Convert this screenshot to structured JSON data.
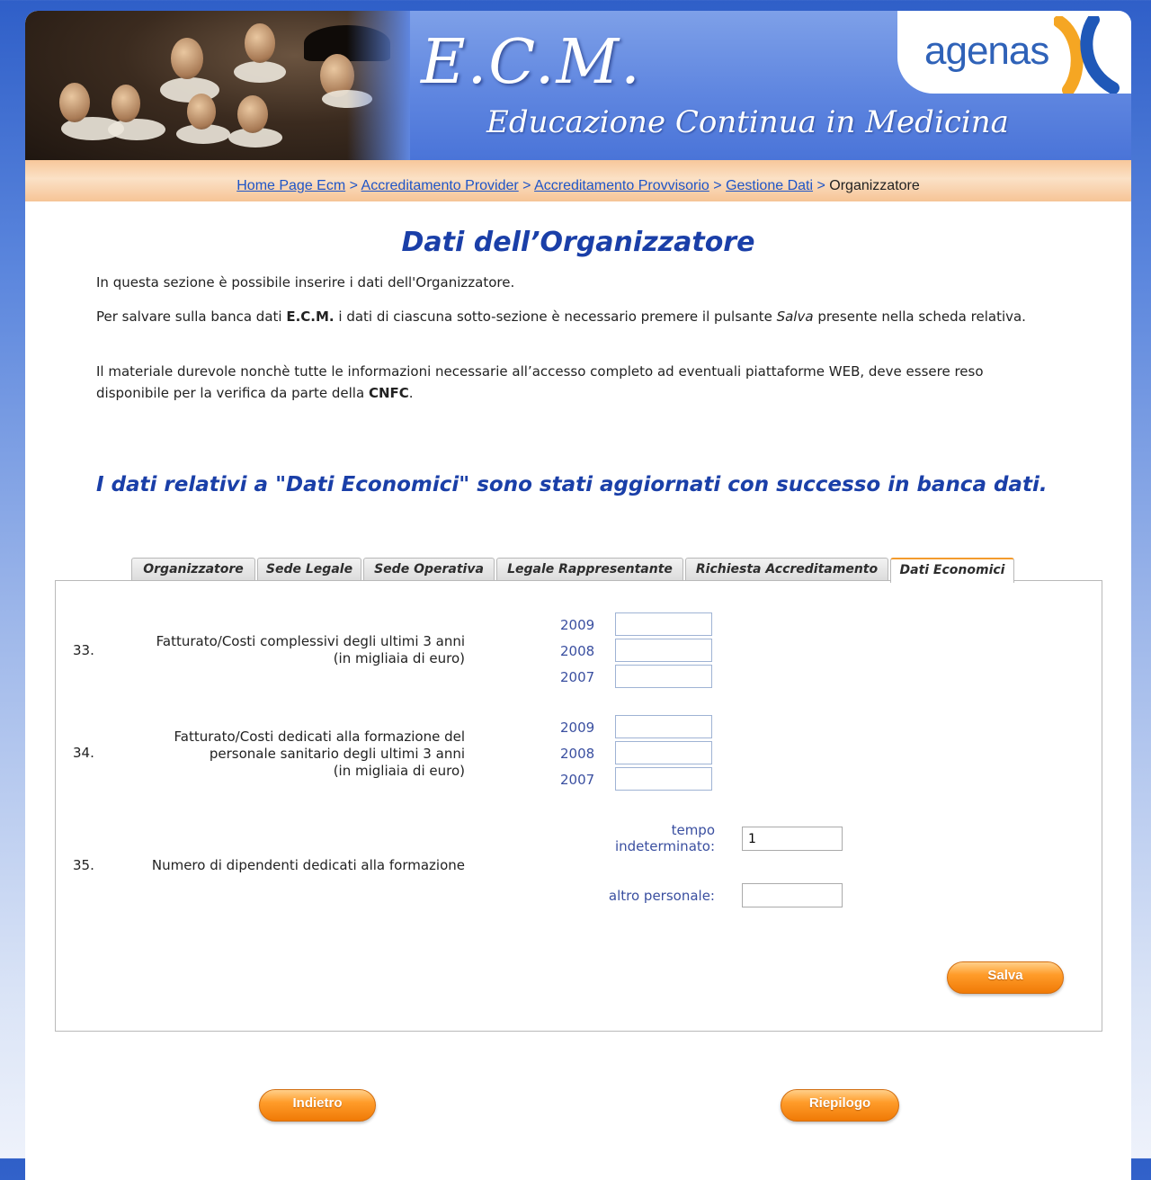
{
  "header": {
    "title": "E.C.M.",
    "subtitle": "Educazione Continua in Medicina",
    "logo_text": "agenas"
  },
  "breadcrumb": {
    "items": [
      "Home Page Ecm",
      "Accreditamento Provider",
      "Accreditamento Provvisorio",
      "Gestione Dati"
    ],
    "separator": ">",
    "current": "Organizzatore"
  },
  "main": {
    "title": "Dati dell’Organizzatore",
    "intro1": "In questa sezione è possibile inserire i dati dell'Organizzatore.",
    "intro2_a": "Per salvare sulla banca dati ",
    "intro2_b": "E.C.M.",
    "intro2_c": " i dati di ciascuna sotto-sezione è necessario premere il pulsante ",
    "intro2_d": "Salva",
    "intro2_e": " presente nella scheda relativa.",
    "intro3_a": "Il materiale durevole nonchè tutte le informazioni necessarie all’accesso completo ad eventuali piattaforme WEB, deve essere reso disponibile per la verifica da parte della ",
    "intro3_b": "CNFC",
    "intro3_c": ".",
    "success_message": "I dati relativi a \"Dati Economici\" sono stati aggiornati con successo in banca dati."
  },
  "tabs": [
    {
      "label": "Organizzatore"
    },
    {
      "label": "Sede Legale"
    },
    {
      "label": "Sede Operativa"
    },
    {
      "label": "Legale Rappresentante"
    },
    {
      "label": "Richiesta Accreditamento"
    },
    {
      "label": "Dati Economici",
      "active": true
    }
  ],
  "form": {
    "q33": {
      "number": "33.",
      "label_line1": "Fatturato/Costi complessivi degli ultimi 3 anni",
      "label_line2": "(in migliaia di euro)",
      "years": [
        "2009",
        "2008",
        "2007"
      ],
      "values": [
        "",
        "",
        ""
      ]
    },
    "q34": {
      "number": "34.",
      "label_line1": "Fatturato/Costi dedicati alla formazione del",
      "label_line2": "personale sanitario degli ultimi 3 anni",
      "label_line3": "(in migliaia di euro)",
      "years": [
        "2009",
        "2008",
        "2007"
      ],
      "values": [
        "",
        "",
        ""
      ]
    },
    "q35": {
      "number": "35.",
      "label": "Numero di dipendenti dedicati alla formazione",
      "tempo_label_line1": "tempo",
      "tempo_label_line2": "indeterminato:",
      "tempo_value": "1",
      "altro_label": "altro personale:",
      "altro_value": ""
    },
    "save_label": "Salva"
  },
  "footer": {
    "back_label": "Indietro",
    "summary_label": "Riepilogo"
  }
}
